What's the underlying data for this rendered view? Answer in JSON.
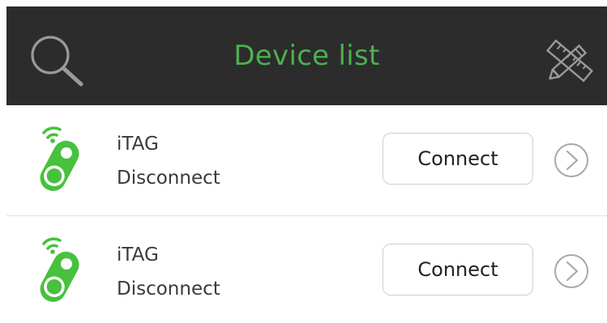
{
  "header": {
    "title": "Device list",
    "title_color": "#4cb050",
    "background": "#2c2c2c",
    "left_icon": "search-icon",
    "right_icon": "tools-icon"
  },
  "devices": [
    {
      "name": "iTAG",
      "status": "Disconnect",
      "button_label": "Connect",
      "icon": "itag-device-icon",
      "icon_color": "#48c13e"
    },
    {
      "name": "iTAG",
      "status": "Disconnect",
      "button_label": "Connect",
      "icon": "itag-device-icon",
      "icon_color": "#48c13e"
    }
  ]
}
